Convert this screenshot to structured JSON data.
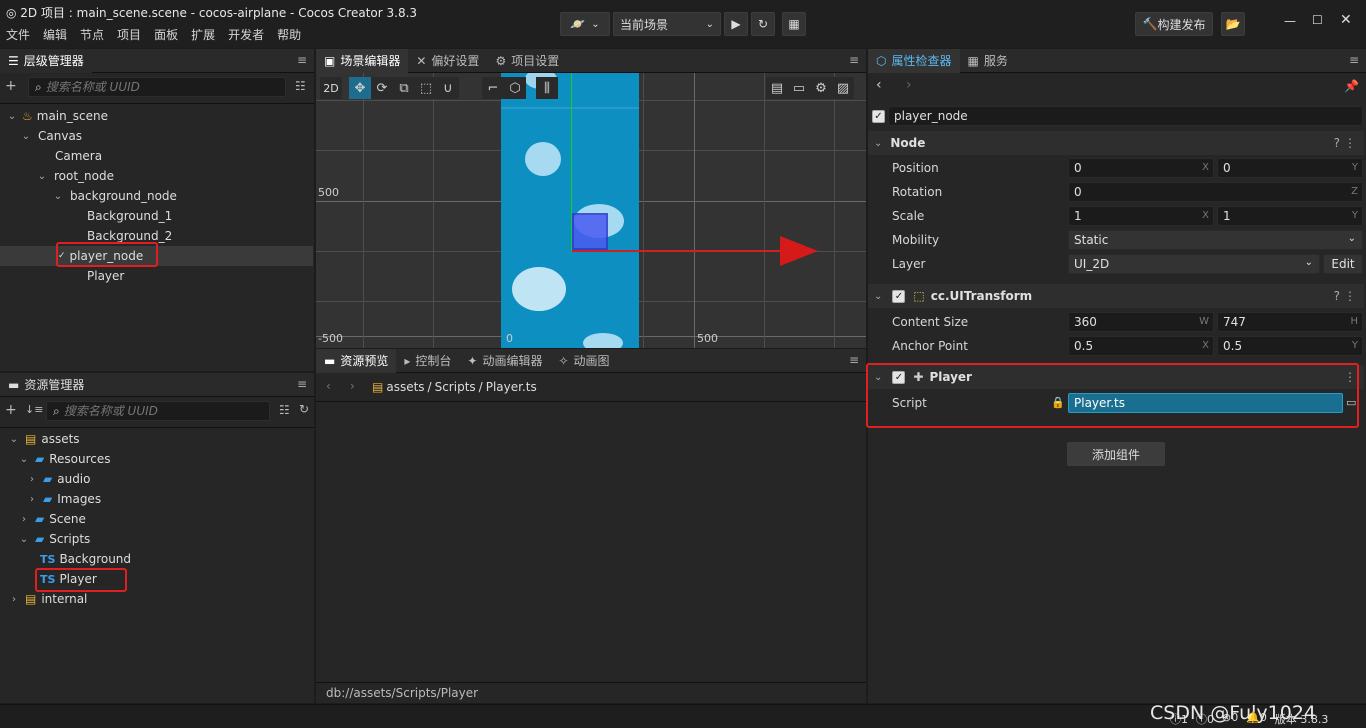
{
  "window": {
    "title": "2D 项目 : main_scene.scene - cocos-airplane - Cocos Creator 3.8.3",
    "menu": [
      "文件",
      "编辑",
      "节点",
      "项目",
      "面板",
      "扩展",
      "开发者",
      "帮助"
    ]
  },
  "toolbar": {
    "scene_select": "当前场景",
    "build_publish": "构建发布"
  },
  "hierarchy": {
    "tab": "层级管理器",
    "search_placeholder": "搜索名称或 UUID",
    "nodes": [
      "main_scene",
      "Canvas",
      "Camera",
      "root_node",
      "background_node",
      "Background_1",
      "Background_2",
      "player_node",
      "Player"
    ]
  },
  "assets": {
    "tab": "资源管理器",
    "search_placeholder": "搜索名称或 UUID",
    "items": [
      "assets",
      "Resources",
      "audio",
      "Images",
      "Scene",
      "Scripts",
      "Background",
      "Player",
      "internal"
    ],
    "ts_badge": "TS"
  },
  "scene": {
    "tabs": [
      "场景编辑器",
      "偏好设置",
      "项目设置"
    ],
    "mode_2d": "2D",
    "labels": {
      "y500": "500",
      "yneg500": "-500",
      "x0": "0",
      "x500": "500"
    }
  },
  "bottom": {
    "tabs": [
      "资源预览",
      "控制台",
      "动画编辑器",
      "动画图"
    ],
    "breadcrumb": [
      "assets",
      "Scripts",
      "Player.ts"
    ],
    "status": "db://assets/Scripts/Player"
  },
  "inspector": {
    "tabs": [
      "属性检查器",
      "服务"
    ],
    "node_name": "player_node",
    "node_section": "Node",
    "position_label": "Position",
    "position": [
      "0",
      "0"
    ],
    "rotation_label": "Rotation",
    "rotation": "0",
    "scale_label": "Scale",
    "scale": [
      "1",
      "1"
    ],
    "mobility_label": "Mobility",
    "mobility": "Static",
    "layer_label": "Layer",
    "layer": "UI_2D",
    "edit": "Edit",
    "uitransform": "cc.UITransform",
    "content_size_label": "Content Size",
    "content_size": [
      "360",
      "747"
    ],
    "anchor_label": "Anchor Point",
    "anchor": [
      "0.5",
      "0.5"
    ],
    "player_section": "Player",
    "script_label": "Script",
    "script": "Player.ts",
    "add_component": "添加组件",
    "axes": {
      "x": "X",
      "y": "Y",
      "z": "Z",
      "w": "W",
      "h": "H"
    }
  },
  "statusbar": {
    "counts": [
      "1",
      "0",
      "0",
      "0"
    ],
    "version": "版本 3.8.3",
    "watermark": "CSDN @Fuly1024"
  }
}
